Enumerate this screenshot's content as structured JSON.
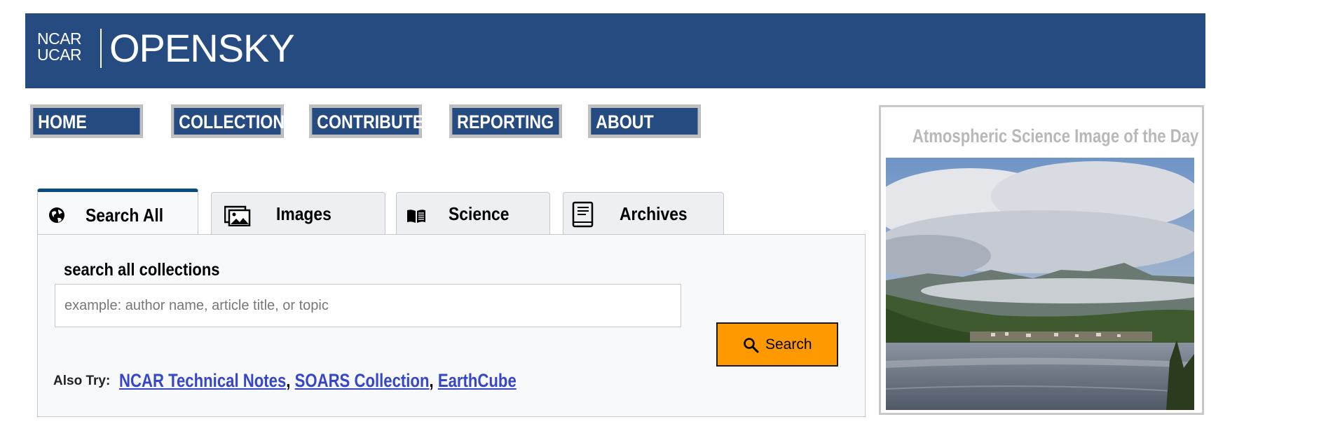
{
  "header": {
    "logo_line1": "NCAR",
    "logo_line2": "UCAR",
    "site_name": "OPENSKY",
    "brand_color": "#264b80"
  },
  "nav": {
    "items": [
      {
        "label": "HOME"
      },
      {
        "label": "COLLECTIONS"
      },
      {
        "label": "CONTRIBUTE"
      },
      {
        "label": "REPORTING"
      },
      {
        "label": "ABOUT"
      }
    ]
  },
  "tabs": [
    {
      "label": "Search All",
      "icon": "globe-icon",
      "active": true
    },
    {
      "label": "Images",
      "icon": "images-icon",
      "active": false
    },
    {
      "label": "Science",
      "icon": "book-open-icon",
      "active": false
    },
    {
      "label": "Archives",
      "icon": "book-icon",
      "active": false
    }
  ],
  "search": {
    "heading": "search all collections",
    "placeholder": "example: author name, article title, or topic",
    "value": "",
    "button_label": "Search",
    "button_icon": "search-icon",
    "button_color": "#ff9900"
  },
  "also_try": {
    "label": "Also Try:",
    "links": [
      {
        "text": "NCAR Technical Notes"
      },
      {
        "text": "SOARS Collection"
      },
      {
        "text": "EarthCube"
      }
    ],
    "separator": ","
  },
  "image_of_day": {
    "title": "Atmospheric Science Image of the Day",
    "image": "landscape-photo-clouds-over-mountain-lake"
  }
}
